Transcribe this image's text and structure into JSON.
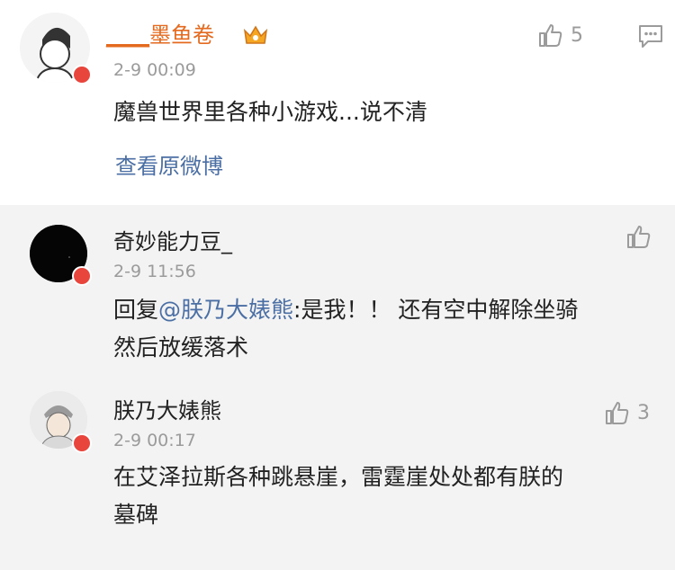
{
  "post": {
    "author_prefix": "____",
    "author_name": "墨鱼卷",
    "vip_icon": "crown-vip-icon",
    "time": "2-9 00:09",
    "text": "魔兽世界里各种小游戏...说不清",
    "view_original": "查看原微博",
    "like_count": "5",
    "like_icon": "thumbs-up-icon",
    "comment_icon": "comment-icon"
  },
  "replies": [
    {
      "author": "奇妙能力豆_",
      "time": "2-9 11:56",
      "reply_prefix": "回复",
      "mention": "@朕乃大婊熊",
      "text": ":是我！！ 还有空中解除坐骑",
      "text_line2": "然后放缓落术",
      "like_count": ""
    },
    {
      "author": "朕乃大婊熊",
      "time": "2-9 00:17",
      "text": "在艾泽拉斯各种跳悬崖，雷霆崖处处都有朕的",
      "text_line2": "墓碑",
      "like_count": "3"
    }
  ],
  "colors": {
    "accent_link": "#4b6fa4",
    "vip_name": "#e46a1f",
    "muted": "#9b9b9b",
    "reply_background": "#f3f3f3"
  }
}
